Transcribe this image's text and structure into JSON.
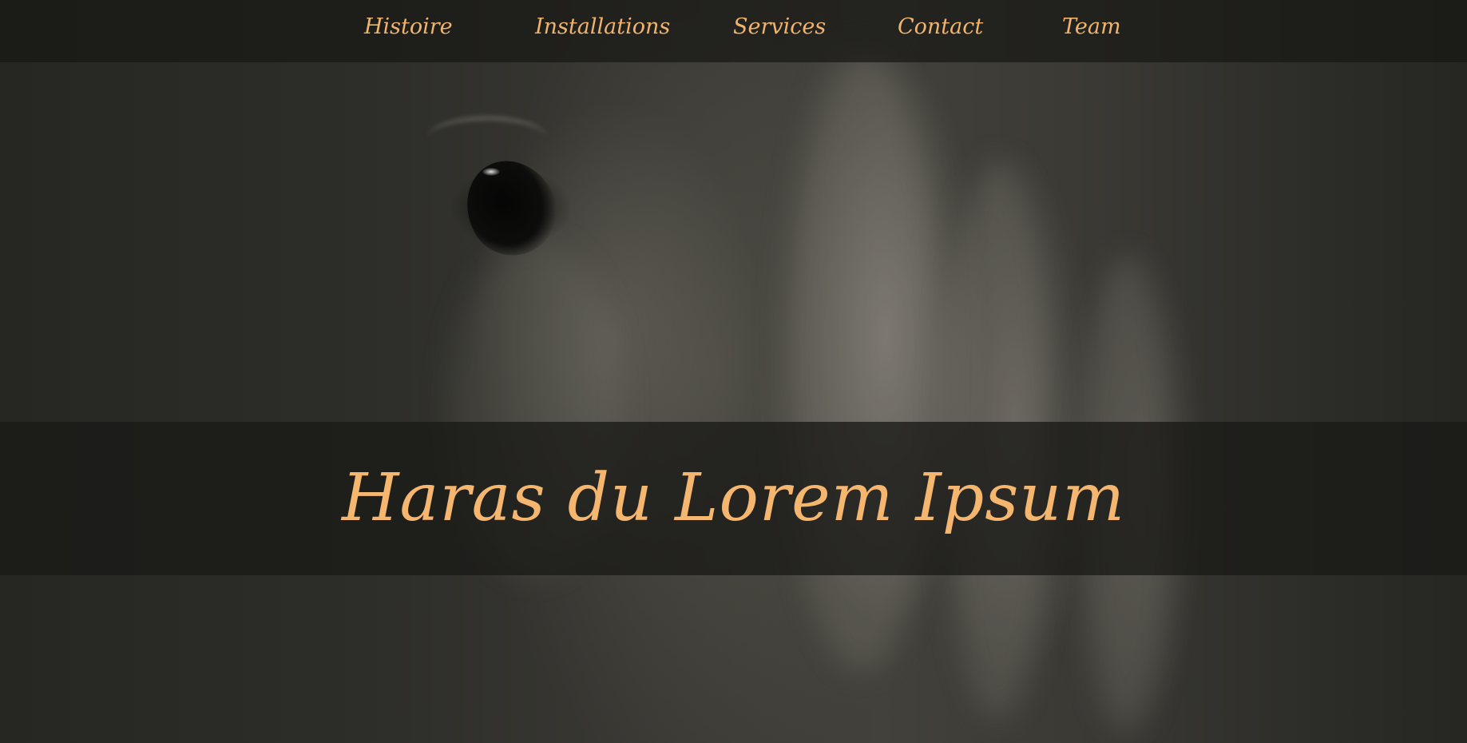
{
  "nav": {
    "items": [
      {
        "label": "Histoire"
      },
      {
        "label": "Installations"
      },
      {
        "label": "Services"
      },
      {
        "label": "Contact"
      },
      {
        "label": "Team"
      }
    ]
  },
  "hero": {
    "title": "Haras du Lorem Ipsum",
    "background_image": "horse-head-closeup"
  },
  "colors": {
    "accent": "#f5b66f",
    "nav_background": "#181815",
    "band_background": "#1a1a17"
  }
}
